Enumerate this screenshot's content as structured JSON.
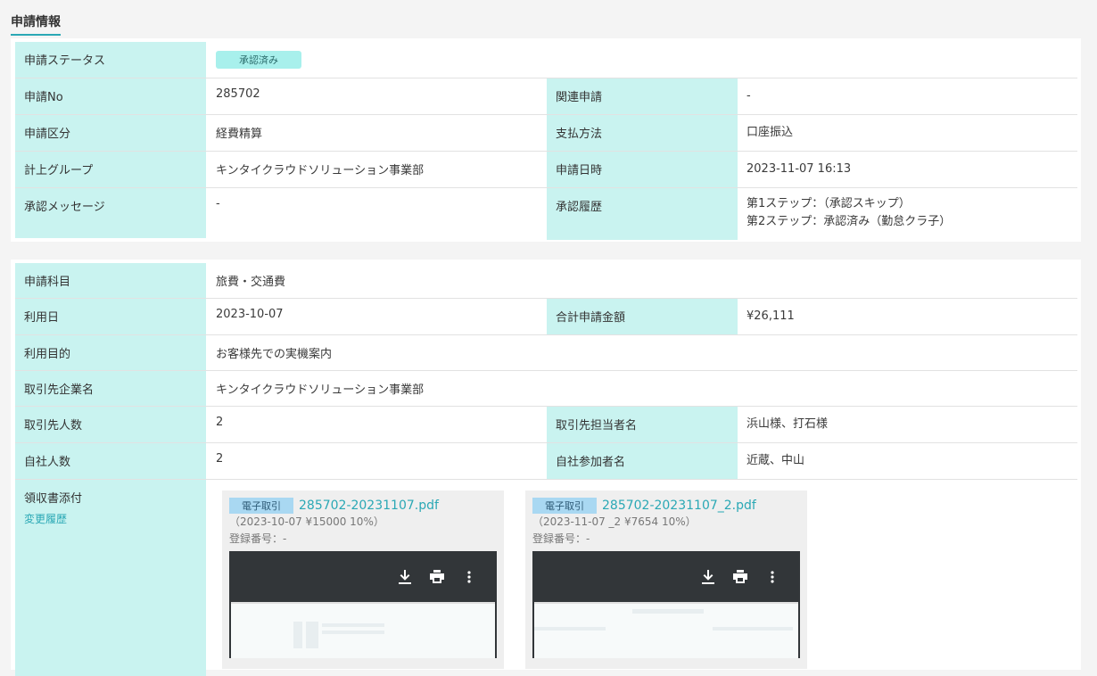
{
  "section_title": "申請情報",
  "card1": {
    "status_label": "申請ステータス",
    "status_value": "承認済み",
    "rows": [
      {
        "l1": "申請No",
        "v1": "285702",
        "l2": "関連申請",
        "v2": "-"
      },
      {
        "l1": "申請区分",
        "v1": "経費精算",
        "l2": "支払方法",
        "v2": "口座振込"
      },
      {
        "l1": "計上グループ",
        "v1": "キンタイクラウドソリューション事業部",
        "l2": "申請日時",
        "v2": "2023-11-07 16:13"
      }
    ],
    "msg_label": "承認メッセージ",
    "msg_value": "-",
    "history_label": "承認履歴",
    "history_1": "第1ステップ：（承認スキップ）",
    "history_2": "第2ステップ：承認済み（勤怠クラ子）"
  },
  "card2": {
    "subject_label": "申請科目",
    "subject_value": "旅費・交通費",
    "date_label": "利用日",
    "date_value": "2023-10-07",
    "total_label": "合計申請金額",
    "total_value": "¥26,111",
    "purpose_label": "利用目的",
    "purpose_value": "お客様先での実機案内",
    "company_label": "取引先企業名",
    "company_value": "キンタイクラウドソリューション事業部",
    "client_count_label": "取引先人数",
    "client_count_value": "2",
    "client_names_label": "取引先担当者名",
    "client_names_value": "浜山様、打石様",
    "own_count_label": "自社人数",
    "own_count_value": "2",
    "own_names_label": "自社参加者名",
    "own_names_value": "近蔵、中山",
    "receipt_label": "領収書添付",
    "history_link": "変更履歴",
    "attachments": [
      {
        "tag": "電子取引",
        "file": "285702-20231107.pdf",
        "meta": "（2023-10-07 ¥15000 10%）",
        "reg": "登録番号：-"
      },
      {
        "tag": "電子取引",
        "file": "285702-20231107_2.pdf",
        "meta": "（2023-11-07 _2 ¥7654 10%）",
        "reg": "登録番号：-"
      }
    ]
  }
}
